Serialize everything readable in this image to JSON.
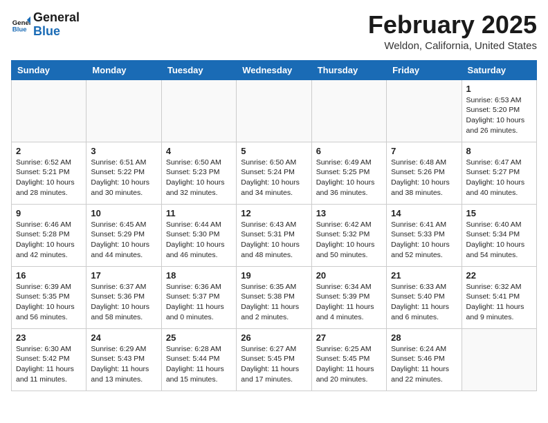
{
  "header": {
    "logo_line1": "General",
    "logo_line2": "Blue",
    "month_year": "February 2025",
    "location": "Weldon, California, United States"
  },
  "weekdays": [
    "Sunday",
    "Monday",
    "Tuesday",
    "Wednesday",
    "Thursday",
    "Friday",
    "Saturday"
  ],
  "weeks": [
    [
      {
        "day": "",
        "info": ""
      },
      {
        "day": "",
        "info": ""
      },
      {
        "day": "",
        "info": ""
      },
      {
        "day": "",
        "info": ""
      },
      {
        "day": "",
        "info": ""
      },
      {
        "day": "",
        "info": ""
      },
      {
        "day": "1",
        "info": "Sunrise: 6:53 AM\nSunset: 5:20 PM\nDaylight: 10 hours and 26 minutes."
      }
    ],
    [
      {
        "day": "2",
        "info": "Sunrise: 6:52 AM\nSunset: 5:21 PM\nDaylight: 10 hours and 28 minutes."
      },
      {
        "day": "3",
        "info": "Sunrise: 6:51 AM\nSunset: 5:22 PM\nDaylight: 10 hours and 30 minutes."
      },
      {
        "day": "4",
        "info": "Sunrise: 6:50 AM\nSunset: 5:23 PM\nDaylight: 10 hours and 32 minutes."
      },
      {
        "day": "5",
        "info": "Sunrise: 6:50 AM\nSunset: 5:24 PM\nDaylight: 10 hours and 34 minutes."
      },
      {
        "day": "6",
        "info": "Sunrise: 6:49 AM\nSunset: 5:25 PM\nDaylight: 10 hours and 36 minutes."
      },
      {
        "day": "7",
        "info": "Sunrise: 6:48 AM\nSunset: 5:26 PM\nDaylight: 10 hours and 38 minutes."
      },
      {
        "day": "8",
        "info": "Sunrise: 6:47 AM\nSunset: 5:27 PM\nDaylight: 10 hours and 40 minutes."
      }
    ],
    [
      {
        "day": "9",
        "info": "Sunrise: 6:46 AM\nSunset: 5:28 PM\nDaylight: 10 hours and 42 minutes."
      },
      {
        "day": "10",
        "info": "Sunrise: 6:45 AM\nSunset: 5:29 PM\nDaylight: 10 hours and 44 minutes."
      },
      {
        "day": "11",
        "info": "Sunrise: 6:44 AM\nSunset: 5:30 PM\nDaylight: 10 hours and 46 minutes."
      },
      {
        "day": "12",
        "info": "Sunrise: 6:43 AM\nSunset: 5:31 PM\nDaylight: 10 hours and 48 minutes."
      },
      {
        "day": "13",
        "info": "Sunrise: 6:42 AM\nSunset: 5:32 PM\nDaylight: 10 hours and 50 minutes."
      },
      {
        "day": "14",
        "info": "Sunrise: 6:41 AM\nSunset: 5:33 PM\nDaylight: 10 hours and 52 minutes."
      },
      {
        "day": "15",
        "info": "Sunrise: 6:40 AM\nSunset: 5:34 PM\nDaylight: 10 hours and 54 minutes."
      }
    ],
    [
      {
        "day": "16",
        "info": "Sunrise: 6:39 AM\nSunset: 5:35 PM\nDaylight: 10 hours and 56 minutes."
      },
      {
        "day": "17",
        "info": "Sunrise: 6:37 AM\nSunset: 5:36 PM\nDaylight: 10 hours and 58 minutes."
      },
      {
        "day": "18",
        "info": "Sunrise: 6:36 AM\nSunset: 5:37 PM\nDaylight: 11 hours and 0 minutes."
      },
      {
        "day": "19",
        "info": "Sunrise: 6:35 AM\nSunset: 5:38 PM\nDaylight: 11 hours and 2 minutes."
      },
      {
        "day": "20",
        "info": "Sunrise: 6:34 AM\nSunset: 5:39 PM\nDaylight: 11 hours and 4 minutes."
      },
      {
        "day": "21",
        "info": "Sunrise: 6:33 AM\nSunset: 5:40 PM\nDaylight: 11 hours and 6 minutes."
      },
      {
        "day": "22",
        "info": "Sunrise: 6:32 AM\nSunset: 5:41 PM\nDaylight: 11 hours and 9 minutes."
      }
    ],
    [
      {
        "day": "23",
        "info": "Sunrise: 6:30 AM\nSunset: 5:42 PM\nDaylight: 11 hours and 11 minutes."
      },
      {
        "day": "24",
        "info": "Sunrise: 6:29 AM\nSunset: 5:43 PM\nDaylight: 11 hours and 13 minutes."
      },
      {
        "day": "25",
        "info": "Sunrise: 6:28 AM\nSunset: 5:44 PM\nDaylight: 11 hours and 15 minutes."
      },
      {
        "day": "26",
        "info": "Sunrise: 6:27 AM\nSunset: 5:45 PM\nDaylight: 11 hours and 17 minutes."
      },
      {
        "day": "27",
        "info": "Sunrise: 6:25 AM\nSunset: 5:45 PM\nDaylight: 11 hours and 20 minutes."
      },
      {
        "day": "28",
        "info": "Sunrise: 6:24 AM\nSunset: 5:46 PM\nDaylight: 11 hours and 22 minutes."
      },
      {
        "day": "",
        "info": ""
      }
    ]
  ]
}
